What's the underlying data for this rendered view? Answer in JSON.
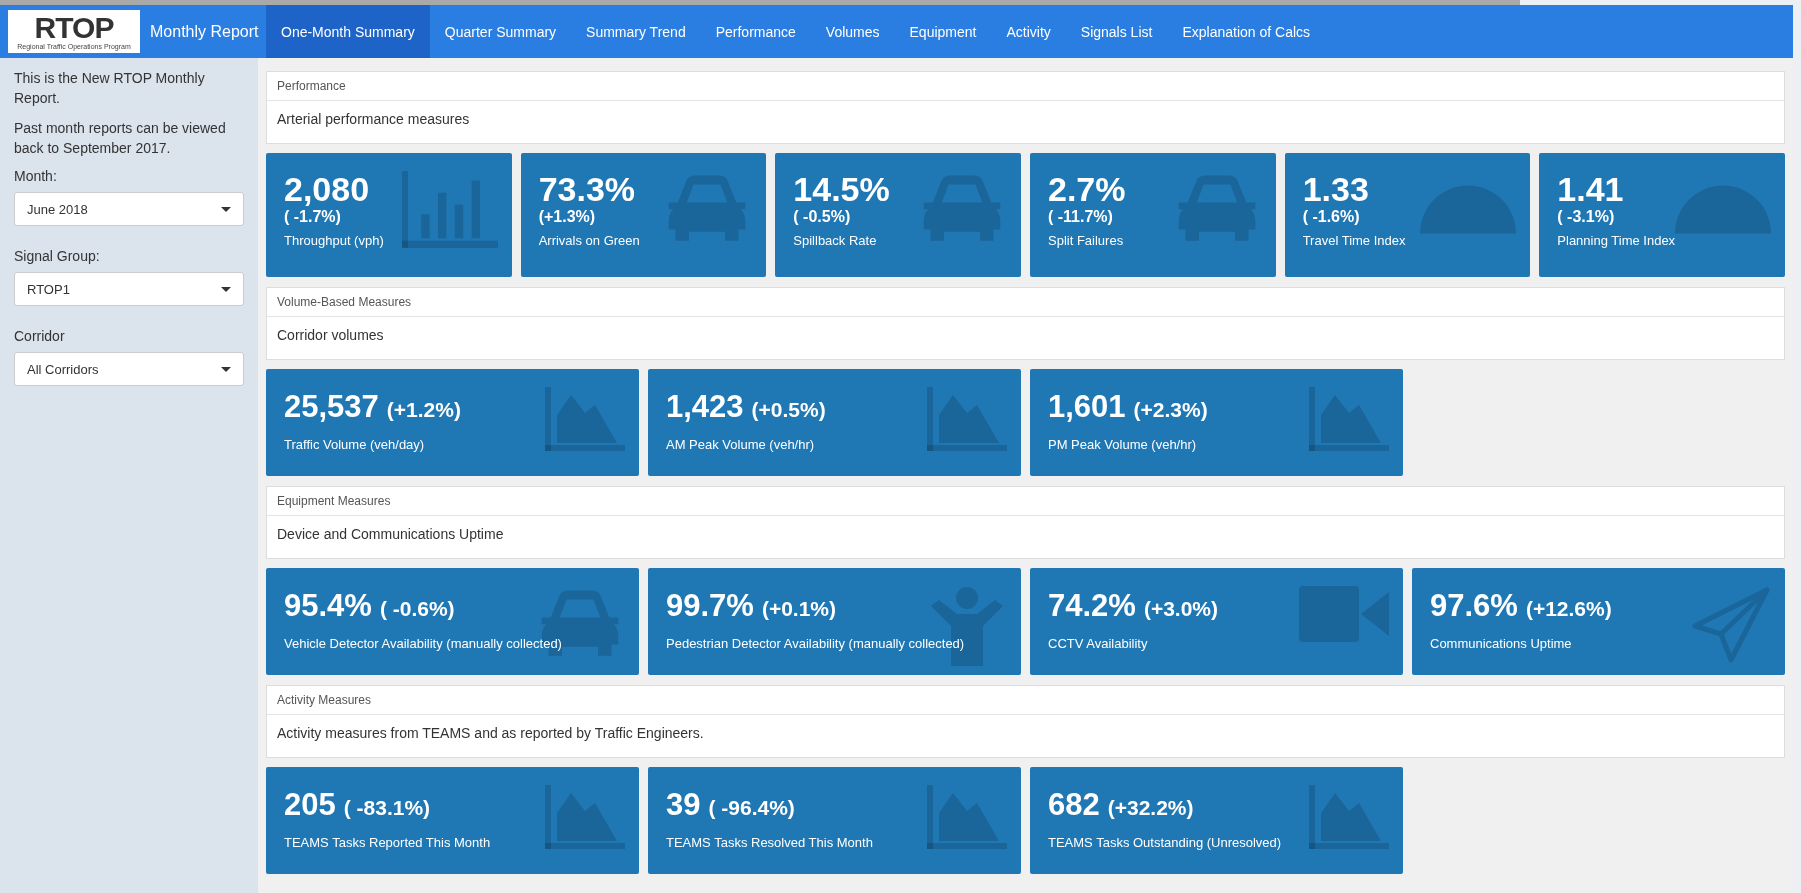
{
  "app": {
    "logo_text": "RTOP",
    "logo_subtitle": "Regional Traffic Operations Program",
    "title": "Monthly Report"
  },
  "tabs": [
    {
      "label": "One-Month Summary",
      "selected": true
    },
    {
      "label": "Quarter Summary",
      "selected": false
    },
    {
      "label": "Summary Trend",
      "selected": false
    },
    {
      "label": "Performance",
      "selected": false
    },
    {
      "label": "Volumes",
      "selected": false
    },
    {
      "label": "Equipment",
      "selected": false
    },
    {
      "label": "Activity",
      "selected": false
    },
    {
      "label": "Signals List",
      "selected": false
    },
    {
      "label": "Explanation of Calcs",
      "selected": false
    }
  ],
  "sidebar": {
    "paragraphs": [
      "This is the New RTOP Monthly Report.",
      "Past month reports can be viewed back to September 2017."
    ],
    "fields": [
      {
        "label": "Month:",
        "value": "June 2018"
      },
      {
        "label": "Signal Group:",
        "value": "RTOP1"
      },
      {
        "label": "Corridor",
        "value": "All Corridors"
      }
    ]
  },
  "sections": [
    {
      "kind": "stacked",
      "title": "Performance",
      "description": "Arterial performance measures",
      "cards": [
        {
          "kind": "bar-chart",
          "value": "2,080",
          "change": "( -1.7%)",
          "label": "Throughput (vph)"
        },
        {
          "kind": "car",
          "value": "73.3%",
          "change": "(+1.3%)",
          "label": "Arrivals on Green"
        },
        {
          "kind": "car",
          "value": "14.5%",
          "change": "( -0.5%)",
          "label": "Spillback Rate"
        },
        {
          "kind": "car",
          "value": "2.7%",
          "change": "( -11.7%)",
          "label": "Split Failures"
        },
        {
          "kind": "gauge",
          "value": "1.33",
          "change": "( -1.6%)",
          "label": "Travel Time Index"
        },
        {
          "kind": "gauge",
          "value": "1.41",
          "change": "( -3.1%)",
          "label": "Planning Time Index"
        }
      ]
    },
    {
      "kind": "inline",
      "title": "Volume-Based Measures",
      "description": "Corridor volumes",
      "cards": [
        {
          "kind": "area-chart",
          "value": "25,537",
          "change": "(+1.2%)",
          "label": "Traffic Volume (veh/day)"
        },
        {
          "kind": "area-chart",
          "value": "1,423",
          "change": "(+0.5%)",
          "label": "AM Peak Volume (veh/hr)"
        },
        {
          "kind": "area-chart",
          "value": "1,601",
          "change": "(+2.3%)",
          "label": "PM Peak Volume (veh/hr)"
        }
      ]
    },
    {
      "kind": "inline",
      "title": "Equipment Measures",
      "description": "Device and Communications Uptime",
      "cards": [
        {
          "kind": "car",
          "value": "95.4%",
          "change": "( -0.6%)",
          "label": "Vehicle Detector Availability (manually collected)"
        },
        {
          "kind": "person",
          "value": "99.7%",
          "change": "(+0.1%)",
          "label": "Pedestrian Detector Availability (manually collected)"
        },
        {
          "kind": "video-camera",
          "value": "74.2%",
          "change": "(+3.0%)",
          "label": "CCTV Availability"
        },
        {
          "kind": "paper-plane",
          "value": "97.6%",
          "change": "(+12.6%)",
          "label": "Communications Uptime"
        }
      ]
    },
    {
      "kind": "inline",
      "title": "Activity Measures",
      "description": "Activity measures from TEAMS and as reported by Traffic Engineers.",
      "cards": [
        {
          "kind": "area-chart",
          "value": "205",
          "change": "( -83.1%)",
          "label": "TEAMS Tasks Reported This Month"
        },
        {
          "kind": "area-chart",
          "value": "39",
          "change": "( -96.4%)",
          "label": "TEAMS Tasks Resolved This Month"
        },
        {
          "kind": "area-chart",
          "value": "682",
          "change": "(+32.2%)",
          "label": "TEAMS Tasks Outstanding (Unresolved)"
        }
      ]
    }
  ]
}
